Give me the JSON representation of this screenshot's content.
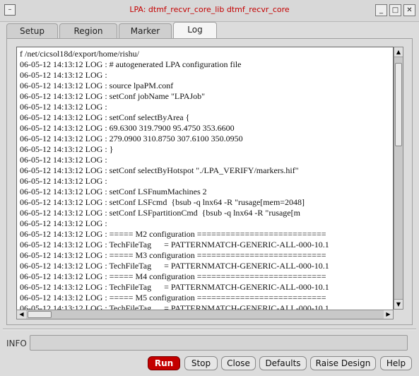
{
  "window": {
    "title": "LPA:  dtmf_recvr_core_lib  dtmf_recvr_core",
    "icon_name": "window-menu-icon",
    "controls": [
      "minimize-icon",
      "maximize-icon",
      "close-icon"
    ]
  },
  "tabs": [
    {
      "label": "Setup",
      "active": false
    },
    {
      "label": "Region",
      "active": false
    },
    {
      "label": "Marker",
      "active": false
    },
    {
      "label": "Log",
      "active": true
    }
  ],
  "log": {
    "lines": [
      "f /net/cicsol18d/export/home/rishu/",
      "06-05-12 14:13:12 LOG : # autogenerated LPA configuration file",
      "06-05-12 14:13:12 LOG :",
      "06-05-12 14:13:12 LOG : source lpaPM.conf",
      "06-05-12 14:13:12 LOG : setConf jobName \"LPAJob\"",
      "06-05-12 14:13:12 LOG :",
      "06-05-12 14:13:12 LOG : setConf selectByArea {",
      "06-05-12 14:13:12 LOG : 69.6300 319.7900 95.4750 353.6600",
      "06-05-12 14:13:12 LOG : 279.0900 310.8750 307.6100 350.0950",
      "06-05-12 14:13:12 LOG : }",
      "06-05-12 14:13:12 LOG :",
      "06-05-12 14:13:12 LOG : setConf selectByHotspot \"./LPA_VERIFY/markers.hif\"",
      "06-05-12 14:13:12 LOG :",
      "06-05-12 14:13:12 LOG : setConf LSFnumMachines 2",
      "06-05-12 14:13:12 LOG : setConf LSFcmd  {bsub -q lnx64 -R \"rusage[mem=2048]",
      "06-05-12 14:13:12 LOG : setConf LSFpartitionCmd  {bsub -q lnx64 -R \"rusage[m",
      "06-05-12 14:13:12 LOG :",
      "06-05-12 14:13:12 LOG : ===== M2 configuration ===========================",
      "06-05-12 14:13:12 LOG : TechFileTag      = PATTERNMATCH-GENERIC-ALL-000-10.1",
      "06-05-12 14:13:12 LOG : ===== M3 configuration ===========================",
      "06-05-12 14:13:12 LOG : TechFileTag      = PATTERNMATCH-GENERIC-ALL-000-10.1",
      "06-05-12 14:13:12 LOG : ===== M4 configuration ===========================",
      "06-05-12 14:13:12 LOG : TechFileTag      = PATTERNMATCH-GENERIC-ALL-000-10.1",
      "06-05-12 14:13:12 LOG : ===== M5 configuration ===========================",
      "06-05-12 14:13:12 LOG : TechFileTag      = PATTERNMATCH-GENERIC-ALL-000-10.1"
    ]
  },
  "info": {
    "label": "INFO",
    "value": ""
  },
  "buttons": {
    "run": "Run",
    "stop": "Stop",
    "close": "Close",
    "defaults": "Defaults",
    "raise_design": "Raise Design",
    "help": "Help"
  },
  "colors": {
    "title_text": "#c40000",
    "run_button": "#c40000"
  }
}
